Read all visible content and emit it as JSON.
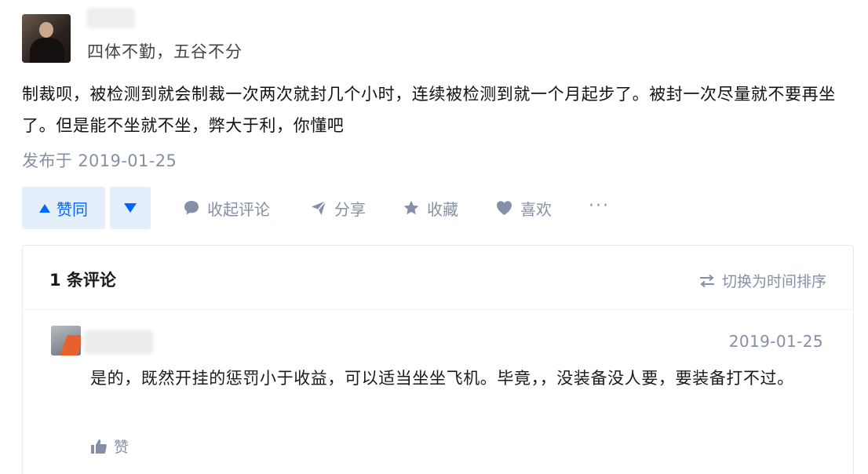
{
  "author": {
    "headline": "四体不勤，五谷不分"
  },
  "answer": {
    "text": "制裁呗，被检测到就会制裁一次两次就封几个小时，连续被检测到就一个月起步了。被封一次尽量就不要再坐了。但是能不坐就不坐，弊大于利，你懂吧",
    "published": "发布于 2019-01-25"
  },
  "actions": {
    "upvote_label": "赞同",
    "collapse_comments": "收起评论",
    "share": "分享",
    "favorite": "收藏",
    "like": "喜欢",
    "more": "···"
  },
  "comments": {
    "count_label": "1 条评论",
    "sort_toggle": "切换为时间排序",
    "items": [
      {
        "date": "2019-01-25",
        "text": "是的，既然开挂的惩罚小于收益，可以适当坐坐飞机。毕竟，，没装备没人要，要装备打不过。",
        "like_label": "赞"
      }
    ]
  },
  "colors": {
    "accent": "#0066ff",
    "vote_bg": "#e5eefb",
    "muted": "#8590a6"
  },
  "icons": [
    "up-arrow-icon",
    "down-arrow-icon",
    "comment-bubble-icon",
    "share-plane-icon",
    "star-icon",
    "heart-icon",
    "swap-arrows-icon",
    "thumb-up-icon"
  ]
}
